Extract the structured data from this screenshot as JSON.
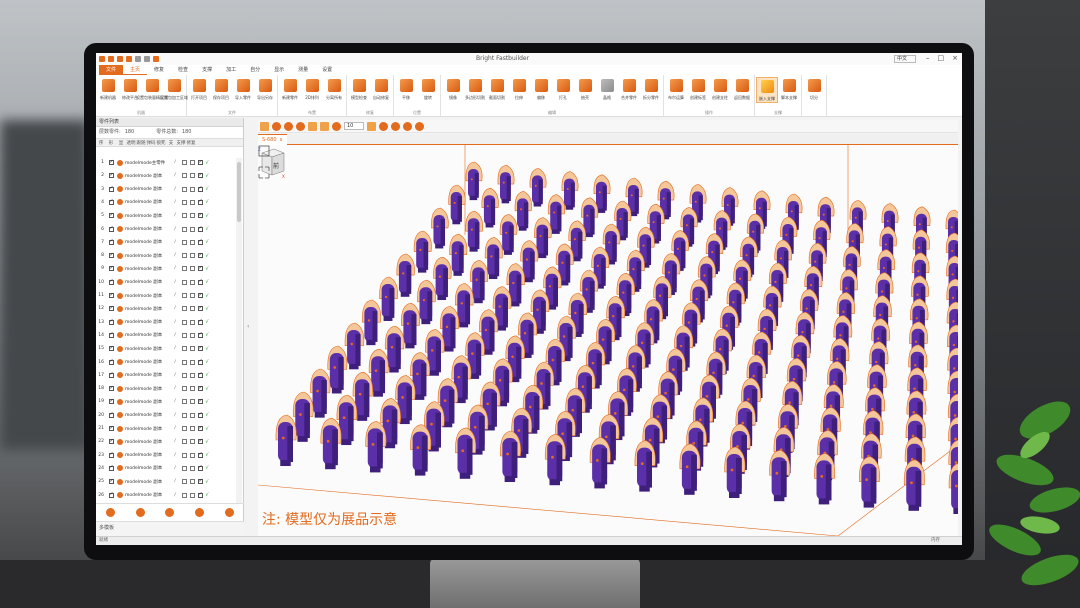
{
  "app": {
    "title": "Bright Fastbuilder",
    "language": "中文",
    "quick_access": [
      "new",
      "open",
      "save",
      "undo",
      "redo",
      "help"
    ]
  },
  "menu": [
    "文件",
    "主页",
    "修复",
    "检查",
    "支撑",
    "加工",
    "自分",
    "显示",
    "测量",
    "设置"
  ],
  "menu_active_index": 1,
  "ribbon": {
    "groups": [
      {
        "name": "机器",
        "buttons": [
          "新建机器",
          "修改平台",
          "设置包装量精区域",
          "设置包加工区域"
        ]
      },
      {
        "name": "文件",
        "buttons": [
          "打开项目",
          "保存项目",
          "导入零件",
          "导出另存"
        ]
      },
      {
        "name": "布置",
        "buttons": [
          "新建零件",
          "2D排列",
          "分离所有"
        ]
      },
      {
        "name": "修复",
        "buttons": [
          "模型检查",
          "自动修复"
        ]
      },
      {
        "name": "位置",
        "buttons": [
          "平移",
          "旋转"
        ]
      },
      {
        "name": "编辑",
        "buttons": [
          "镜像",
          "多边形切割",
          "截面切割",
          "拉伸",
          "偏移",
          "打孔",
          "抽壳",
          "晶格",
          "合并零件",
          "拆分零件"
        ]
      },
      {
        "name": "操作",
        "buttons": [
          "布尔运算",
          "创建标签",
          "创建支柱",
          "返回数据"
        ]
      },
      {
        "name": "支撑",
        "buttons": [
          "嵌入支撑",
          "脚本支撑"
        ]
      },
      {
        "name": "",
        "buttons": [
          "切分"
        ]
      }
    ],
    "active_button": "嵌入支撑"
  },
  "left_panel": {
    "title": "零件列表",
    "stats": {
      "label1": "层数零件:",
      "value1": "180",
      "label2": "零件总数:",
      "value2": "180"
    },
    "columns": [
      "序",
      "形",
      "显",
      "透明",
      "跟随",
      "弹码",
      "锁死",
      "支",
      "支撑",
      "修复"
    ],
    "rows": [
      {
        "n": "1",
        "name": "modelmode主零件"
      },
      {
        "n": "2",
        "name": "modelmode 副本"
      },
      {
        "n": "3",
        "name": "modelmode 副本"
      },
      {
        "n": "4",
        "name": "modelmode 副本"
      },
      {
        "n": "5",
        "name": "modelmode 副本"
      },
      {
        "n": "6",
        "name": "modelmode 副本"
      },
      {
        "n": "7",
        "name": "modelmode 副本"
      },
      {
        "n": "8",
        "name": "modelmode 副本"
      },
      {
        "n": "9",
        "name": "modelmode 副本"
      },
      {
        "n": "10",
        "name": "modelmode 副本"
      },
      {
        "n": "11",
        "name": "modelmode 副本"
      },
      {
        "n": "12",
        "name": "modelmode 副本"
      },
      {
        "n": "13",
        "name": "modelmode 副本"
      },
      {
        "n": "14",
        "name": "modelmode 副本"
      },
      {
        "n": "15",
        "name": "modelmode 副本"
      },
      {
        "n": "16",
        "name": "modelmode 副本"
      },
      {
        "n": "17",
        "name": "modelmode 副本"
      },
      {
        "n": "18",
        "name": "modelmode 副本"
      },
      {
        "n": "19",
        "name": "modelmode 副本"
      },
      {
        "n": "20",
        "name": "modelmode 副本"
      },
      {
        "n": "21",
        "name": "modelmode 副本"
      },
      {
        "n": "22",
        "name": "modelmode 副本"
      },
      {
        "n": "23",
        "name": "modelmode 副本"
      },
      {
        "n": "24",
        "name": "modelmode 副本"
      },
      {
        "n": "25",
        "name": "modelmode 副本"
      },
      {
        "n": "26",
        "name": "modelmode 副本"
      }
    ],
    "multi_label": "多模板"
  },
  "viewport": {
    "zoom_value": "10",
    "tab_label": "S-680",
    "tab_close": "x",
    "note": "注: 模型仅为展品示意",
    "view_cube_label": "前",
    "colors": {
      "part": "#5b2fa8",
      "part_dark": "#3e1f7c",
      "cap": "#f4c79b",
      "accent": "#e36b1e"
    }
  },
  "status": {
    "left": "就绪",
    "right": "内存"
  }
}
